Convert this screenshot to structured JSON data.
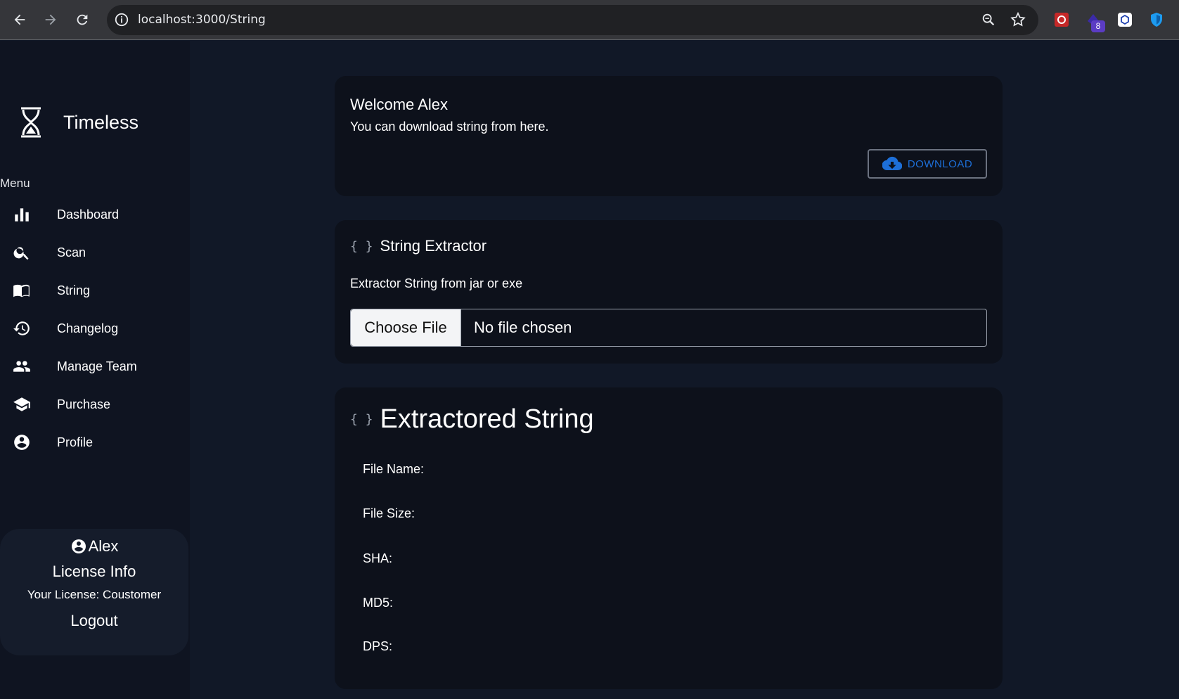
{
  "browser": {
    "url": "localhost:3000/String",
    "extension_badge": "8"
  },
  "sidebar": {
    "brand": "Timeless",
    "menu_label": "Menu",
    "items": [
      {
        "label": "Dashboard",
        "icon": "bar-chart-icon"
      },
      {
        "label": "Scan",
        "icon": "search-icon"
      },
      {
        "label": "String",
        "icon": "book-icon"
      },
      {
        "label": "Changelog",
        "icon": "history-icon"
      },
      {
        "label": "Manage Team",
        "icon": "people-icon"
      },
      {
        "label": "Purchase",
        "icon": "school-icon"
      },
      {
        "label": "Profile",
        "icon": "account-circle-icon"
      }
    ],
    "user": {
      "name": "Alex",
      "license_title": "License Info",
      "license_text": "Your License: Coustomer",
      "logout": "Logout"
    }
  },
  "welcome": {
    "title": "Welcome Alex",
    "subtitle": "You can download string from here.",
    "download_label": "DOWNLOAD"
  },
  "extractor": {
    "title": "String Extractor",
    "subtitle": "Extractor String from jar or exe",
    "choose_file": "Choose File",
    "file_status": "No file chosen"
  },
  "result": {
    "title": "Extractored String",
    "fields": [
      "File Name:",
      "File Size:",
      "SHA:",
      "MD5:",
      "DPS:"
    ]
  }
}
